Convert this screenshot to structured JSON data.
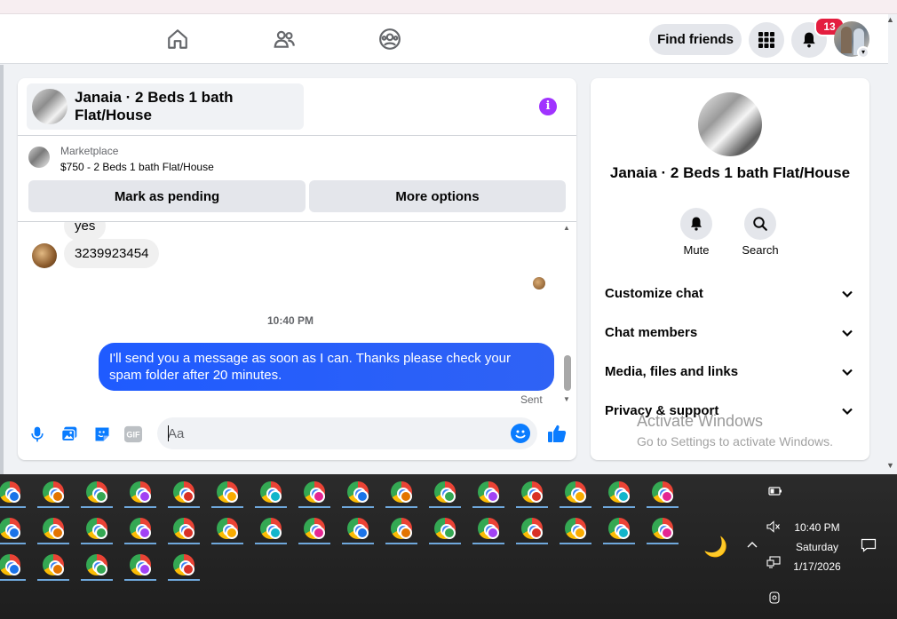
{
  "header": {
    "find_friends_label": "Find friends",
    "notification_count": "13"
  },
  "chat": {
    "title": "Janaia · 2 Beds 1 bath Flat/House",
    "marketplace_label": "Marketplace",
    "listing_price_title": "$750 - 2 Beds 1 bath Flat/House",
    "mark_pending_label": "Mark as pending",
    "more_options_label": "More options",
    "messages": [
      {
        "from": "other",
        "text": "yes"
      },
      {
        "from": "other",
        "text": "3239923454"
      }
    ],
    "timestamp": "10:40 PM",
    "outgoing_message": "I'll send you a message as soon as I can. Thanks please check your spam folder after 20 minutes.",
    "sent_status": "Sent",
    "composer_placeholder": "Aa"
  },
  "info_panel": {
    "title": "Janaia · 2 Beds 1 bath Flat/House",
    "mute_label": "Mute",
    "search_label": "Search",
    "sections": [
      "Customize chat",
      "Chat members",
      "Media, files and links",
      "Privacy & support"
    ]
  },
  "watermark": {
    "line1": "Activate Windows",
    "line2": "Go to Settings to activate Windows."
  },
  "taskbar": {
    "time": "10:40 PM",
    "day": "Saturday",
    "date": "1/17/2026",
    "profile_colors": [
      "#1a73e8",
      "#e37400",
      "#34a853",
      "#a142f4",
      "#d93025",
      "#f9ab00",
      "#12b5cb",
      "#e52592"
    ]
  },
  "colors": {
    "accent_blue": "#0a7cff",
    "info_purple": "#a033ff",
    "badge_red": "#e41e3f"
  }
}
